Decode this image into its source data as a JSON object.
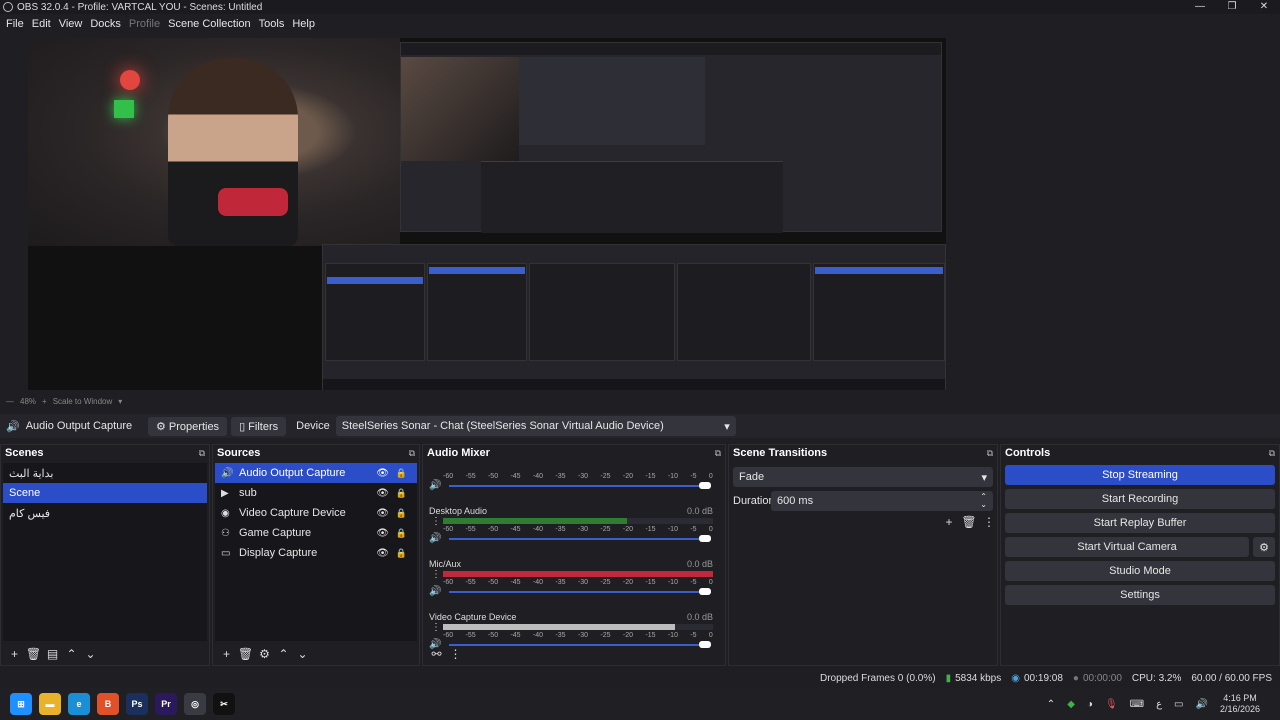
{
  "window": {
    "title": "OBS 32.0.4 - Profile: VARTCAL YOU - Scenes: Untitled",
    "controls": [
      "—",
      "❐",
      "✕"
    ]
  },
  "menu": [
    "File",
    "Edit",
    "View",
    "Docks",
    "Profile",
    "Scene Collection",
    "Tools",
    "Help"
  ],
  "preview": {
    "zoom": "48%",
    "zoom_mode": "Scale to Window"
  },
  "properties_bar": {
    "source_name": "Audio Output Capture",
    "properties_label": "Properties",
    "filters_label": "Filters",
    "device_label": "Device",
    "device_value": "SteelSeries Sonar - Chat (SteelSeries Sonar Virtual Audio Device)"
  },
  "scenes": {
    "title": "Scenes",
    "items": [
      "بداية البث",
      "Scene",
      "فيس كام"
    ],
    "selected_index": 1
  },
  "sources": {
    "title": "Sources",
    "items": [
      {
        "label": "Audio Output Capture",
        "icon": "speaker-icon",
        "glyph": "🔊"
      },
      {
        "label": "sub",
        "icon": "media-icon",
        "glyph": "▶"
      },
      {
        "label": "Video Capture Device",
        "icon": "camera-icon",
        "glyph": "◉"
      },
      {
        "label": "Game Capture",
        "icon": "gamepad-icon",
        "glyph": "⚇"
      },
      {
        "label": "Display Capture",
        "icon": "monitor-icon",
        "glyph": "▭"
      }
    ],
    "selected_index": 0
  },
  "mixer": {
    "title": "Audio Mixer",
    "ticks": [
      "-60",
      "-55",
      "-50",
      "-45",
      "-40",
      "-35",
      "-30",
      "-25",
      "-20",
      "-15",
      "-10",
      "-5",
      "0"
    ],
    "channels": [
      {
        "name": "",
        "db": "",
        "level": 0.0,
        "color": "#2b2b33"
      },
      {
        "name": "Desktop Audio",
        "db": "0.0 dB",
        "level": 0.68,
        "color": "#2e7d32"
      },
      {
        "name": "Mic/Aux",
        "db": "0.0 dB",
        "level": 1.0,
        "color": "#c2283c"
      },
      {
        "name": "Video Capture Device",
        "db": "0.0 dB",
        "level": 0.86,
        "color": "#bdbdbd"
      }
    ]
  },
  "transitions": {
    "title": "Scene Transitions",
    "type": "Fade",
    "duration_label": "Duration",
    "duration_value": "600 ms"
  },
  "controls": {
    "title": "Controls",
    "buttons": [
      "Stop Streaming",
      "Start Recording",
      "Start Replay Buffer",
      "Start Virtual Camera",
      "Studio Mode",
      "Settings"
    ],
    "active_index": 0
  },
  "status": {
    "dropped_frames": "Dropped Frames 0 (0.0%)",
    "bitrate": "5834 kbps",
    "stream_time": "00:19:08",
    "record_time": "00:00:00",
    "cpu": "CPU: 3.2%",
    "fps": "60.00 / 60.00 FPS"
  },
  "taskbar": {
    "time": "4:16 PM",
    "date": "2/16/2026",
    "lang": "ع",
    "apps": [
      {
        "name": "windows-start-icon",
        "glyph": "⊞",
        "color": "#1e90ff"
      },
      {
        "name": "file-explorer-icon",
        "glyph": "▬",
        "color": "#e8b32a"
      },
      {
        "name": "edge-icon",
        "glyph": "e",
        "color": "#1a8fd6"
      },
      {
        "name": "brave-icon",
        "glyph": "B",
        "color": "#e0512a"
      },
      {
        "name": "photoshop-icon",
        "glyph": "Ps",
        "color": "#1b2f5c"
      },
      {
        "name": "premiere-icon",
        "glyph": "Pr",
        "color": "#2a1a5c"
      },
      {
        "name": "obs-icon",
        "glyph": "◎",
        "color": "#3a3a42"
      },
      {
        "name": "capcut-icon",
        "glyph": "✂",
        "color": "#111111"
      }
    ]
  }
}
